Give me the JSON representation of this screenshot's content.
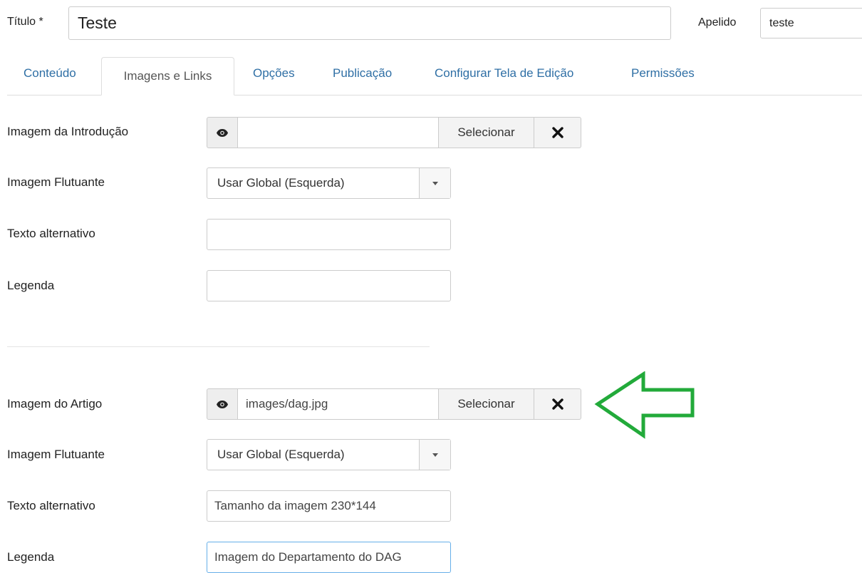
{
  "header": {
    "title_label": "Título *",
    "title_value": "Teste",
    "alias_label": "Apelido",
    "alias_value": "teste"
  },
  "tabs": [
    {
      "label": "Conteúdo"
    },
    {
      "label": "Imagens e Links",
      "active": true
    },
    {
      "label": "Opções"
    },
    {
      "label": "Publicação"
    },
    {
      "label": "Configurar Tela de Edição"
    },
    {
      "label": "Permissões"
    }
  ],
  "intro": {
    "image_label": "Imagem da Introdução",
    "image_value": "",
    "select_label": "Selecionar",
    "float_label": "Imagem Flutuante",
    "float_value": "Usar Global (Esquerda)",
    "alt_label": "Texto alternativo",
    "alt_value": "",
    "caption_label": "Legenda",
    "caption_value": ""
  },
  "article": {
    "image_label": "Imagem do Artigo",
    "image_value": "images/dag.jpg",
    "select_label": "Selecionar",
    "float_label": "Imagem Flutuante",
    "float_value": "Usar Global (Esquerda)",
    "alt_label": "Texto alternativo",
    "alt_value": "Tamanho da imagem 230*144",
    "caption_label": "Legenda",
    "caption_value": "Imagem do Departamento do DAG"
  },
  "annotation": {
    "arrow_color": "#22aa3a",
    "arrow_icon": "left-arrow-outline"
  },
  "icons": {
    "preview": "eye-icon",
    "clear": "close-icon",
    "dropdown": "caret-down-icon"
  }
}
